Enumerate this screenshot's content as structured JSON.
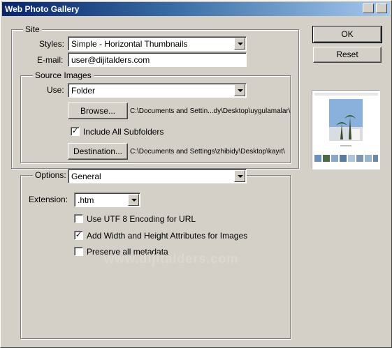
{
  "window": {
    "title": "Web Photo Gallery"
  },
  "site": {
    "legend": "Site",
    "styles_label": "Styles:",
    "styles_value": "Simple - Horizontal Thumbnails",
    "email_label": "E-mail:",
    "email_value": "user@dijitalders.com"
  },
  "source": {
    "legend": "Source Images",
    "use_label": "Use:",
    "use_value": "Folder",
    "browse_label": "Browse...",
    "browse_path": "C:\\Documents and Settin...dy\\Desktop\\uygulamalar\\",
    "include_subfolders_label": "Include All Subfolders",
    "include_subfolders_checked": true,
    "destination_label": "Destination...",
    "destination_path": "C:\\Documents and Settings\\zhibidy\\Desktop\\kayıt\\"
  },
  "options": {
    "label": "Options:",
    "value": "General",
    "extension_label": "Extension:",
    "extension_value": ".htm",
    "utf8_label": "Use UTF 8 Encoding for URL",
    "utf8_checked": false,
    "width_height_label": "Add Width and Height Attributes for Images",
    "width_height_checked": true,
    "metadata_label": "Preserve all metadata",
    "metadata_checked": false
  },
  "buttons": {
    "ok": "OK",
    "reset": "Reset"
  },
  "watermark": "www.dijitalders.com",
  "colors": {
    "titlebar": "#0a246a",
    "dialog": "#d4d0c8"
  },
  "icons": {
    "dropdown": "chevron-down-icon",
    "check": "checkmark-icon"
  }
}
